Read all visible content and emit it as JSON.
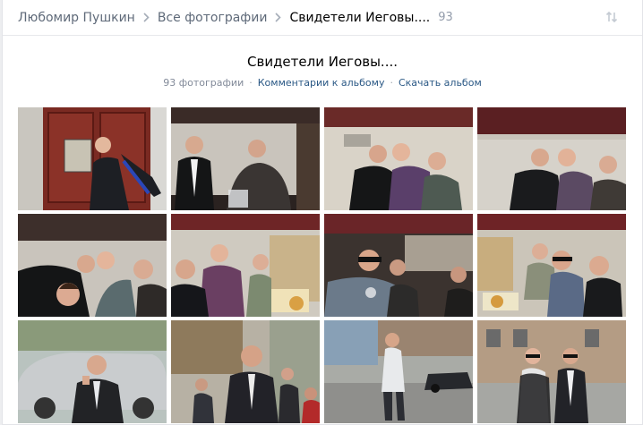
{
  "breadcrumbs": {
    "owner": "Любомир Пушкин",
    "all_photos": "Все фотографии",
    "album": "Свидетели Иеговы....",
    "count": "93"
  },
  "album": {
    "title": "Свидетели Иеговы....",
    "photo_count": "93 фотографии",
    "comments_link": "Комментарии к альбому",
    "download_link": "Скачать альбом"
  },
  "photos": [
    {
      "subject": "man leaning at red wooden door with sign"
    },
    {
      "subject": "two people in train compartment"
    },
    {
      "subject": "group sitting in train compartment"
    },
    {
      "subject": "group sitting in train compartment"
    },
    {
      "subject": "group lying in train berth"
    },
    {
      "subject": "man in suit with woman in checked shirt"
    },
    {
      "subject": "man in sunglasses with headphones"
    },
    {
      "subject": "group in train compartment with food"
    },
    {
      "subject": "man in suit on street with cars"
    },
    {
      "subject": "man in suit outdoors with crowd"
    },
    {
      "subject": "man walking on city street"
    },
    {
      "subject": "couple in sunglasses on street"
    }
  ],
  "colors": {
    "link": "#2a5885",
    "muted": "#828a99",
    "breadcrumb": "#5f6a79"
  }
}
